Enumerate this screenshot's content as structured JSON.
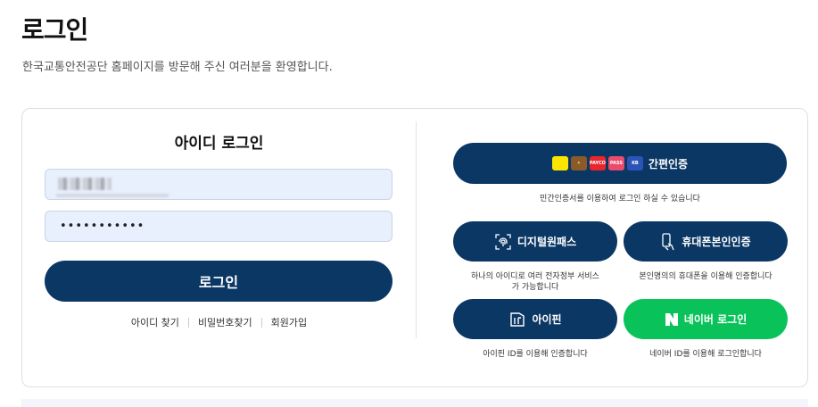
{
  "page": {
    "title": "로그인",
    "subtitle": "한국교통안전공단 홈페이지를 방문해 주신 여러분을 환영합니다."
  },
  "id_login": {
    "heading": "아이디 로그인",
    "id_value": "",
    "password_value": "•••••••••••",
    "login_button": "로그인",
    "links": [
      "아이디 찾기",
      "비밀번호찾기",
      "회원가입"
    ]
  },
  "cert": {
    "simple": {
      "label": "간편인증",
      "logos": [
        "kakao",
        "toss",
        "PAYCO",
        "PASS",
        "KB"
      ],
      "desc": "민간인증서를 이용하여 로그인 하실 수 있습니다"
    },
    "digital": {
      "label": "디지털원패스",
      "icon": "fingerprint-icon",
      "desc_line1": "하나의 아이디로 여러 전자정부 서비스",
      "desc_line2": "가 가능합니다"
    },
    "phone": {
      "label": "휴대폰본인인증",
      "icon": "phone-hand-icon",
      "desc": "본인명의의 휴대폰을 이용해 인증합니다"
    },
    "ipin": {
      "label": "아이핀",
      "icon": "ipin-card-icon",
      "desc": "아이핀 ID를 이용해 인증합니다"
    },
    "naver": {
      "label": "네이버 로그인",
      "icon": "naver-n-icon",
      "desc": "네이버 ID를 이용해 로그인합니다"
    }
  },
  "colors": {
    "primary": "#0b3764",
    "naver": "#09c35a",
    "field_bg": "#e8f0fe"
  }
}
